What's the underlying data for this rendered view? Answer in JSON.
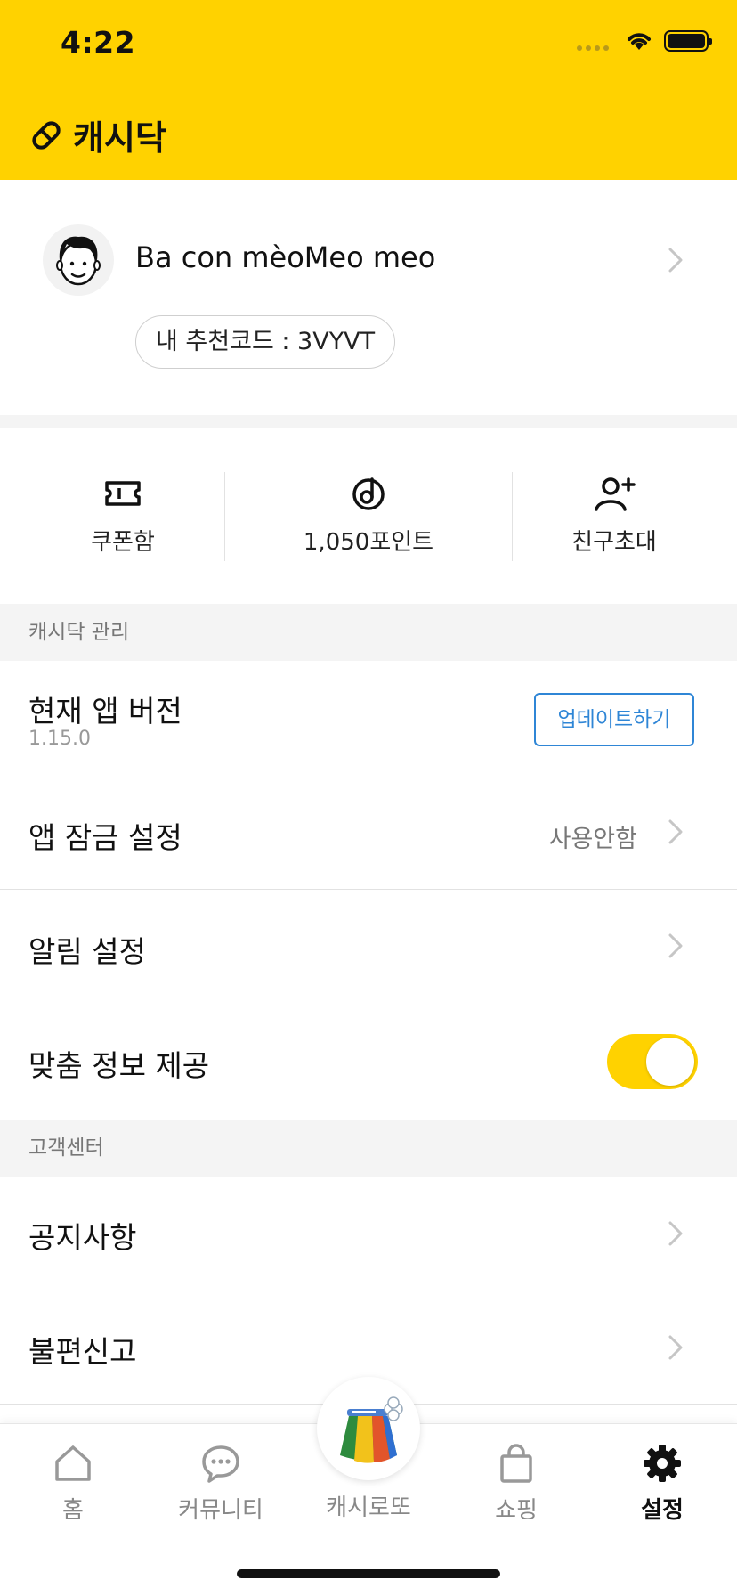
{
  "status_bar": {
    "time": "4:22"
  },
  "app": {
    "name": "캐시닥",
    "brand_color": "#FFD200",
    "accent_blue": "#2f86d6"
  },
  "profile": {
    "name": "Ba con mèoMeo meo",
    "referral_code_label": "내 추천코드 : 3VYVT"
  },
  "quick_actions": [
    {
      "icon": "ticket-icon",
      "label": "쿠폰함"
    },
    {
      "icon": "point-icon",
      "label": "1,050포인트"
    },
    {
      "icon": "add-friend-icon",
      "label": "친구초대"
    }
  ],
  "sections": {
    "manage": {
      "title": "캐시닥 관리",
      "app_version": {
        "label": "현재 앱 버전",
        "version": "1.15.0",
        "update_button": "업데이트하기"
      },
      "app_lock": {
        "label": "앱 잠금 설정",
        "value": "사용안함"
      },
      "notifications": {
        "label": "알림 설정"
      },
      "custom_info": {
        "label": "맞춤 정보 제공",
        "enabled": true
      }
    },
    "support": {
      "title": "고객센터",
      "notice": {
        "label": "공지사항"
      },
      "report": {
        "label": "불편신고"
      }
    }
  },
  "tabbar": {
    "tabs": [
      {
        "icon": "home-icon",
        "label": "홈"
      },
      {
        "icon": "chat-bubble-icon",
        "label": "커뮤니티"
      },
      {
        "icon": "lotto-icon",
        "label": "캐시로또"
      },
      {
        "icon": "shopping-bag-icon",
        "label": "쇼핑"
      },
      {
        "icon": "gear-icon",
        "label": "설정",
        "active": true
      }
    ]
  }
}
